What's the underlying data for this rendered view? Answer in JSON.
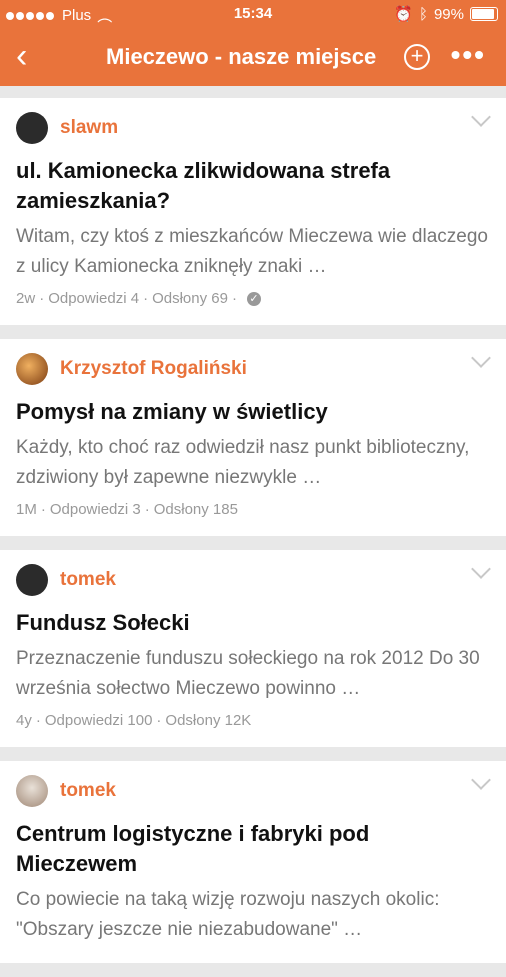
{
  "status_bar": {
    "carrier": "Plus",
    "time": "15:34",
    "battery": "99%"
  },
  "nav": {
    "title": "Mieczewo - nasze miejsce"
  },
  "colors": {
    "accent": "#e9733b",
    "background": "#e8e8e8"
  },
  "posts": [
    {
      "user": "slawm",
      "title": "ul. Kamionecka  zlikwidowana strefa zamieszkania?",
      "excerpt": "Witam, czy ktoś z mieszkańców Mieczewa wie dlaczego z ulicy Kamionecka zniknęły znaki …",
      "age": "2w",
      "replies": "Odpowiedzi 4",
      "views": "Odsłony 69",
      "avatar_color": "#2b2b2b",
      "solved": true
    },
    {
      "user": "Krzysztof Rogaliński",
      "title": "Pomysł na zmiany w świetlicy",
      "excerpt": "Każdy, kto choć raz odwiedził nasz punkt biblioteczny, zdziwiony był zapewne niezwykle …",
      "age": "1M",
      "replies": "Odpowiedzi 3",
      "views": "Odsłony 185",
      "avatar_color": "#7a3a10",
      "solved": false
    },
    {
      "user": "tomek",
      "title": "Fundusz Sołecki",
      "excerpt": "Przeznaczenie funduszu sołeckiego na rok 2012 Do 30 września sołectwo Mieczewo powinno …",
      "age": "4y",
      "replies": "Odpowiedzi 100",
      "views": "Odsłony 12K",
      "avatar_color": "#2b2b2b",
      "solved": false
    },
    {
      "user": "tomek",
      "title": "Centrum logistyczne i fabryki pod Mieczewem",
      "excerpt": "Co powiecie na taką wizję rozwoju naszych okolic: \"Obszary jeszcze nie niezabudowane\" …",
      "age": "",
      "replies": "",
      "views": "",
      "avatar_color": "#c9b7a8",
      "solved": false
    }
  ]
}
